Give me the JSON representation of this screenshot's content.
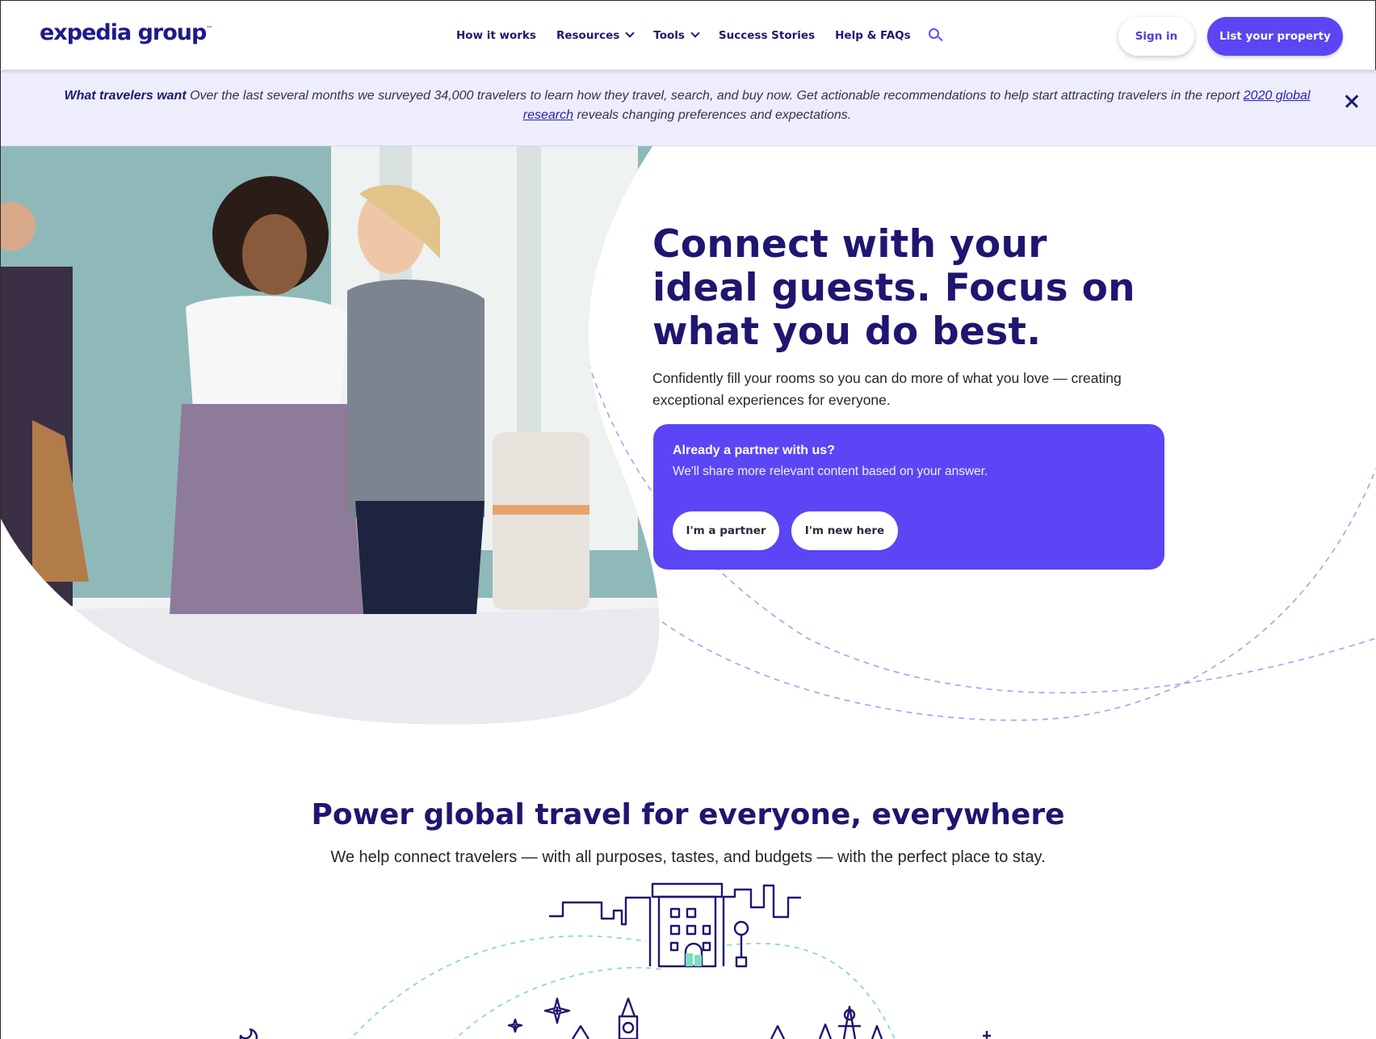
{
  "header": {
    "logo_text": "expedia group",
    "logo_tm": "™",
    "nav": {
      "how_it_works": "How it works",
      "resources": "Resources",
      "tools": "Tools",
      "success_stories": "Success Stories",
      "help_faqs": "Help & FAQs"
    },
    "sign_in": "Sign in",
    "list_property": "List your property"
  },
  "banner": {
    "lead": "What travelers want",
    "text": " Over the last several months we surveyed 34,000 travelers to learn how they travel, search, and buy now. Get actionable recommendations to help start attracting travelers in the report ",
    "link": "2020 global research",
    "tail": " reveals changing preferences and expectations."
  },
  "hero": {
    "title": "Connect with your ideal guests. Focus on what you do best.",
    "subtitle": "Confidently fill your rooms so you can do more of what you love — creating exceptional experiences for everyone.",
    "card_title": "Already a partner with us?",
    "card_text": "We'll share more relevant content based on your answer.",
    "partner_btn": "I'm a partner",
    "new_btn": "I'm new here"
  },
  "section": {
    "title": "Power global travel for everyone, everywhere",
    "subtitle": "We help connect travelers — with all purposes, tastes, and budgets — with the perfect place to stay."
  },
  "colors": {
    "brand_navy": "#1e1670",
    "accent_purple": "#5b45f5",
    "banner_bg": "#ededfc",
    "teal": "#7fdcc0"
  }
}
